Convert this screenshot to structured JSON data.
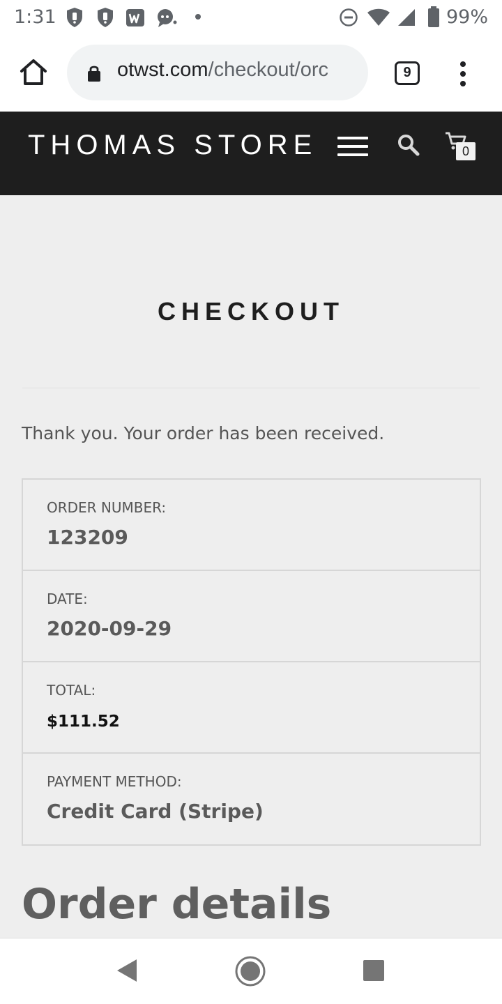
{
  "status_bar": {
    "time": "1:31",
    "battery": "99%",
    "notification_icons": [
      "shield-icon",
      "shield-icon",
      "w-app-icon",
      "chat-icon",
      "dot-icon"
    ],
    "system_icons": [
      "dnd-icon",
      "wifi-icon",
      "signal-icon",
      "battery-icon"
    ]
  },
  "browser": {
    "url_host": "otwst.com",
    "url_path": "/checkout/orc",
    "tab_count": "9"
  },
  "site": {
    "logo": "THOMAS STORE",
    "cart_count": "0"
  },
  "page": {
    "title": "CHECKOUT",
    "thank_you": "Thank you. Your order has been received.",
    "order_rows": [
      {
        "label": "ORDER NUMBER:",
        "value": "123209"
      },
      {
        "label": "DATE:",
        "value": "2020-09-29"
      },
      {
        "label": "TOTAL:",
        "value": "$111.52"
      },
      {
        "label": "PAYMENT METHOD:",
        "value": "Credit Card (Stripe)"
      }
    ],
    "order_details_heading": "Order details"
  },
  "colors": {
    "header_bg": "#1e1e1e",
    "content_bg": "#eeeeee",
    "border": "#d6d6d6"
  }
}
